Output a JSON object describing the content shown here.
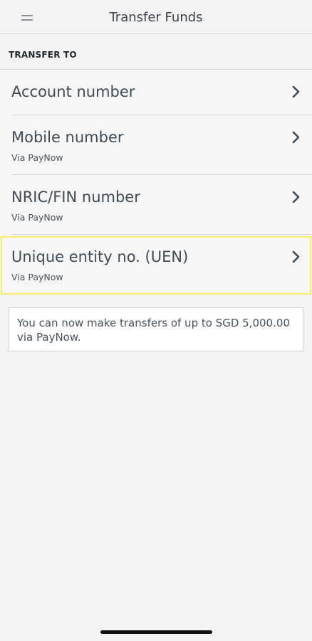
{
  "header": {
    "title": "Transfer Funds",
    "menu_icon": "menu-icon"
  },
  "section": {
    "label": "TRANSFER TO"
  },
  "options": [
    {
      "title": "Account number",
      "subtitle": ""
    },
    {
      "title": "Mobile number",
      "subtitle": "Via PayNow"
    },
    {
      "title": "NRIC/FIN number",
      "subtitle": "Via PayNow"
    },
    {
      "title": "Unique entity no. (UEN)",
      "subtitle": "Via PayNow"
    }
  ],
  "info": {
    "text": "You can now make transfers of up to SGD 5,000.00 via PayNow."
  },
  "colors": {
    "background": "#f3f3f3",
    "text": "#3f4b55",
    "highlight": "#f5f06a",
    "divider": "#d8d8d8"
  }
}
